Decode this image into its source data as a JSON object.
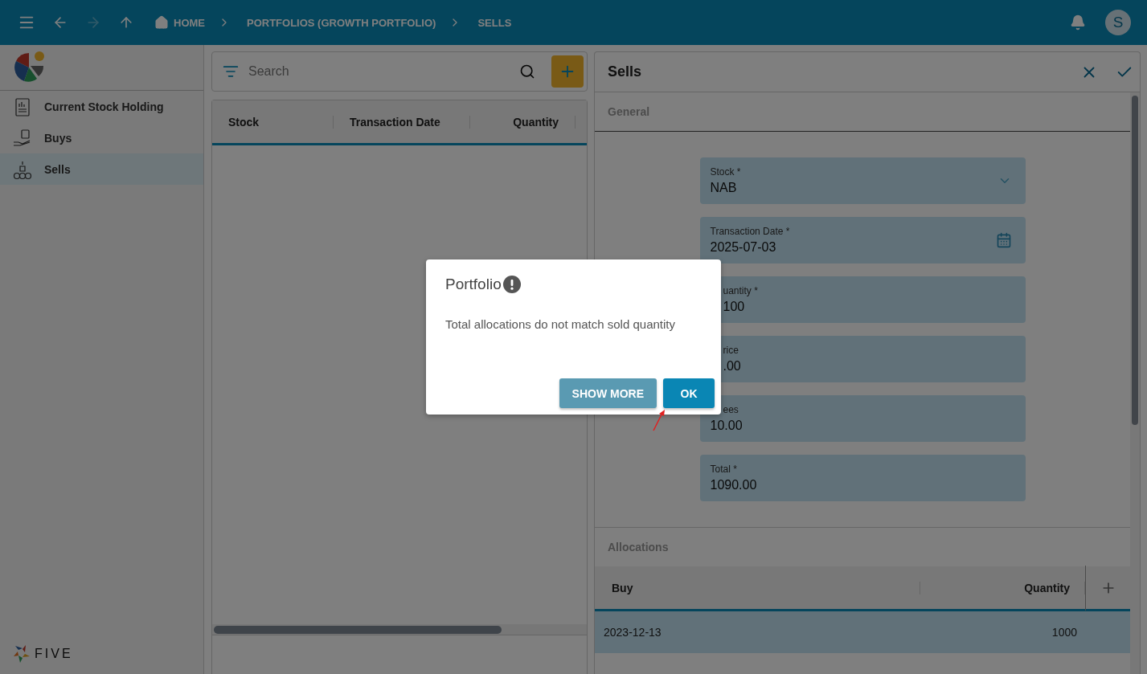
{
  "top_bar": {
    "nav": [
      {
        "kind": "back",
        "disabled": false
      },
      {
        "kind": "forward",
        "disabled": true
      },
      {
        "kind": "up",
        "disabled": false
      }
    ],
    "breadcrumbs": [
      {
        "kind": "home",
        "label": "HOME"
      },
      {
        "kind": "page",
        "label": "PORTFOLIOS (GROWTH PORTFOLIO)"
      },
      {
        "kind": "page",
        "label": "SELLS"
      }
    ],
    "avatar": "S"
  },
  "sidebar": {
    "items": [
      {
        "kind": "report",
        "label": "Current Stock Holding",
        "selected": false
      },
      {
        "kind": "buy",
        "label": "Buys",
        "selected": false
      },
      {
        "kind": "sell",
        "label": "Sells",
        "selected": true
      }
    ],
    "footer_logo": "FIVE"
  },
  "list": {
    "search": {
      "placeholder": "Search"
    },
    "columns": [
      "Stock",
      "Transaction Date",
      "Quantity"
    ]
  },
  "form": {
    "title": "Sells",
    "section": "General",
    "fields": [
      {
        "kind": "select",
        "label": "Stock *",
        "value": "NAB",
        "label_cut": false,
        "value_cut": false
      },
      {
        "kind": "date",
        "label": "Transaction Date *",
        "value": "2025-07-03",
        "label_cut": false,
        "value_cut": false
      },
      {
        "kind": "text",
        "label": "uantity *",
        "value": "100",
        "label_cut": true,
        "value_cut": true
      },
      {
        "kind": "text",
        "label": "rice",
        "value": ".00",
        "label_cut": true,
        "value_cut": true
      },
      {
        "kind": "text",
        "label": "ees",
        "value": "10.00",
        "label_cut": true,
        "value_cut": false
      },
      {
        "kind": "text",
        "label": "Total *",
        "value": "1090.00",
        "label_cut": false,
        "value_cut": false
      }
    ],
    "allocations": {
      "title": "Allocations",
      "columns": [
        "Buy",
        "Quantity"
      ],
      "rows": [
        {
          "buy": "2023-12-13",
          "quantity": "1000",
          "selected": true
        }
      ]
    }
  },
  "dialog": {
    "title": "Portfolio",
    "message": "Total allocations do not match sold quantity",
    "buttons": [
      {
        "kind": "secondary",
        "label": "SHOW MORE"
      },
      {
        "kind": "primary",
        "label": "OK"
      }
    ]
  }
}
